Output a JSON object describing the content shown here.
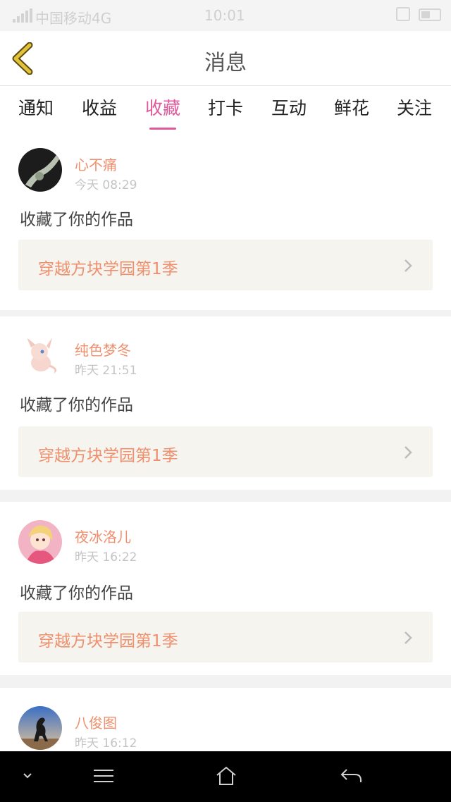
{
  "status_bar": {
    "carrier": "中国移动4G",
    "time": "10:01"
  },
  "header": {
    "title": "消息",
    "back_icon": "chevron-left-icon",
    "accent_color": "#c9a52a"
  },
  "tabs": [
    {
      "label": "通知",
      "active": false
    },
    {
      "label": "收益",
      "active": false
    },
    {
      "label": "收藏",
      "active": true
    },
    {
      "label": "打卡",
      "active": false
    },
    {
      "label": "互动",
      "active": false
    },
    {
      "label": "鲜花",
      "active": false
    },
    {
      "label": "关注",
      "active": false
    }
  ],
  "active_color": "#e05a9b",
  "messages": [
    {
      "name": "心不痛",
      "time": "今天 08:29",
      "action": "收藏了你的作品",
      "work_title": "穿越方块学园第1季"
    },
    {
      "name": "纯色梦冬",
      "time": "昨天 21:51",
      "action": "收藏了你的作品",
      "work_title": "穿越方块学园第1季"
    },
    {
      "name": "夜冰洛儿",
      "time": "昨天 16:22",
      "action": "收藏了你的作品",
      "work_title": "穿越方块学园第1季"
    },
    {
      "name": "八俊图",
      "time": "昨天 16:12",
      "action": "",
      "work_title": ""
    }
  ],
  "system_nav": [
    "chevron-down-icon",
    "menu-icon",
    "home-icon",
    "back-arrow-icon"
  ]
}
